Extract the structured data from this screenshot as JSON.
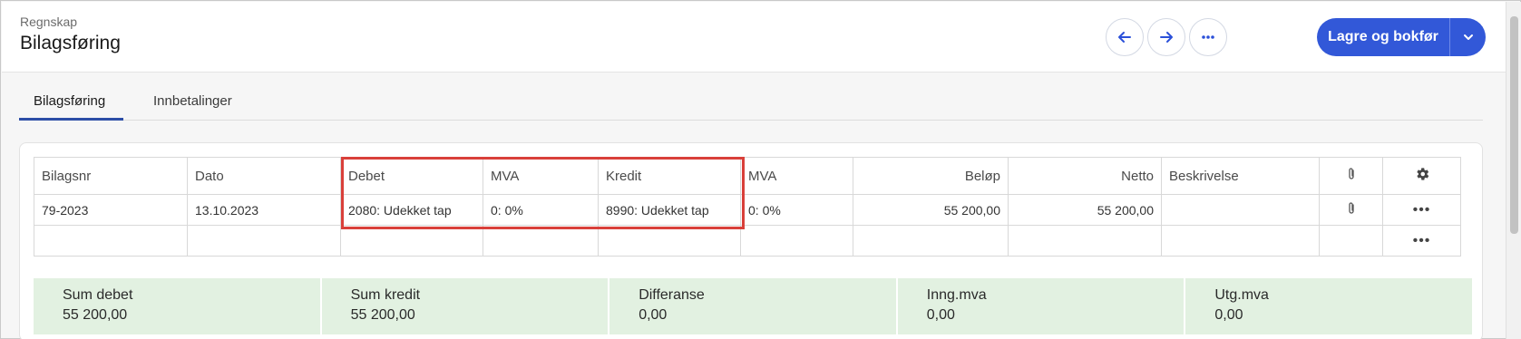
{
  "header": {
    "breadcrumb": "Regnskap",
    "title": "Bilagsføring",
    "back_icon": "arrow-left-icon",
    "forward_icon": "arrow-right-icon",
    "more_icon": "more-horizontal-icon",
    "primary_label": "Lagre og bokfør",
    "accent": "#3258d8"
  },
  "tabs": [
    {
      "label": "Bilagsføring",
      "active": true
    },
    {
      "label": "Innbetalinger",
      "active": false
    }
  ],
  "table": {
    "columns": [
      "Bilagsnr",
      "Dato",
      "Debet",
      "MVA",
      "Kredit",
      "MVA",
      "Beløp",
      "Netto",
      "Beskrivelse",
      "",
      ""
    ],
    "rows": [
      {
        "bilagsnr": "79-2023",
        "dato": "13.10.2023",
        "debet": "2080: Udekket tap",
        "mva1": "0: 0%",
        "kredit": "8990: Udekket tap",
        "mva2": "0: 0%",
        "belop": "55 200,00",
        "netto": "55 200,00",
        "beskrivelse": ""
      }
    ],
    "highlight_color": "#d9403a"
  },
  "summary": [
    {
      "label": "Sum debet",
      "value": "55 200,00"
    },
    {
      "label": "Sum kredit",
      "value": "55 200,00"
    },
    {
      "label": "Differanse",
      "value": "0,00"
    },
    {
      "label": "Inng.mva",
      "value": "0,00"
    },
    {
      "label": "Utg.mva",
      "value": "0,00"
    }
  ],
  "summary_color": "#e2f1e1"
}
